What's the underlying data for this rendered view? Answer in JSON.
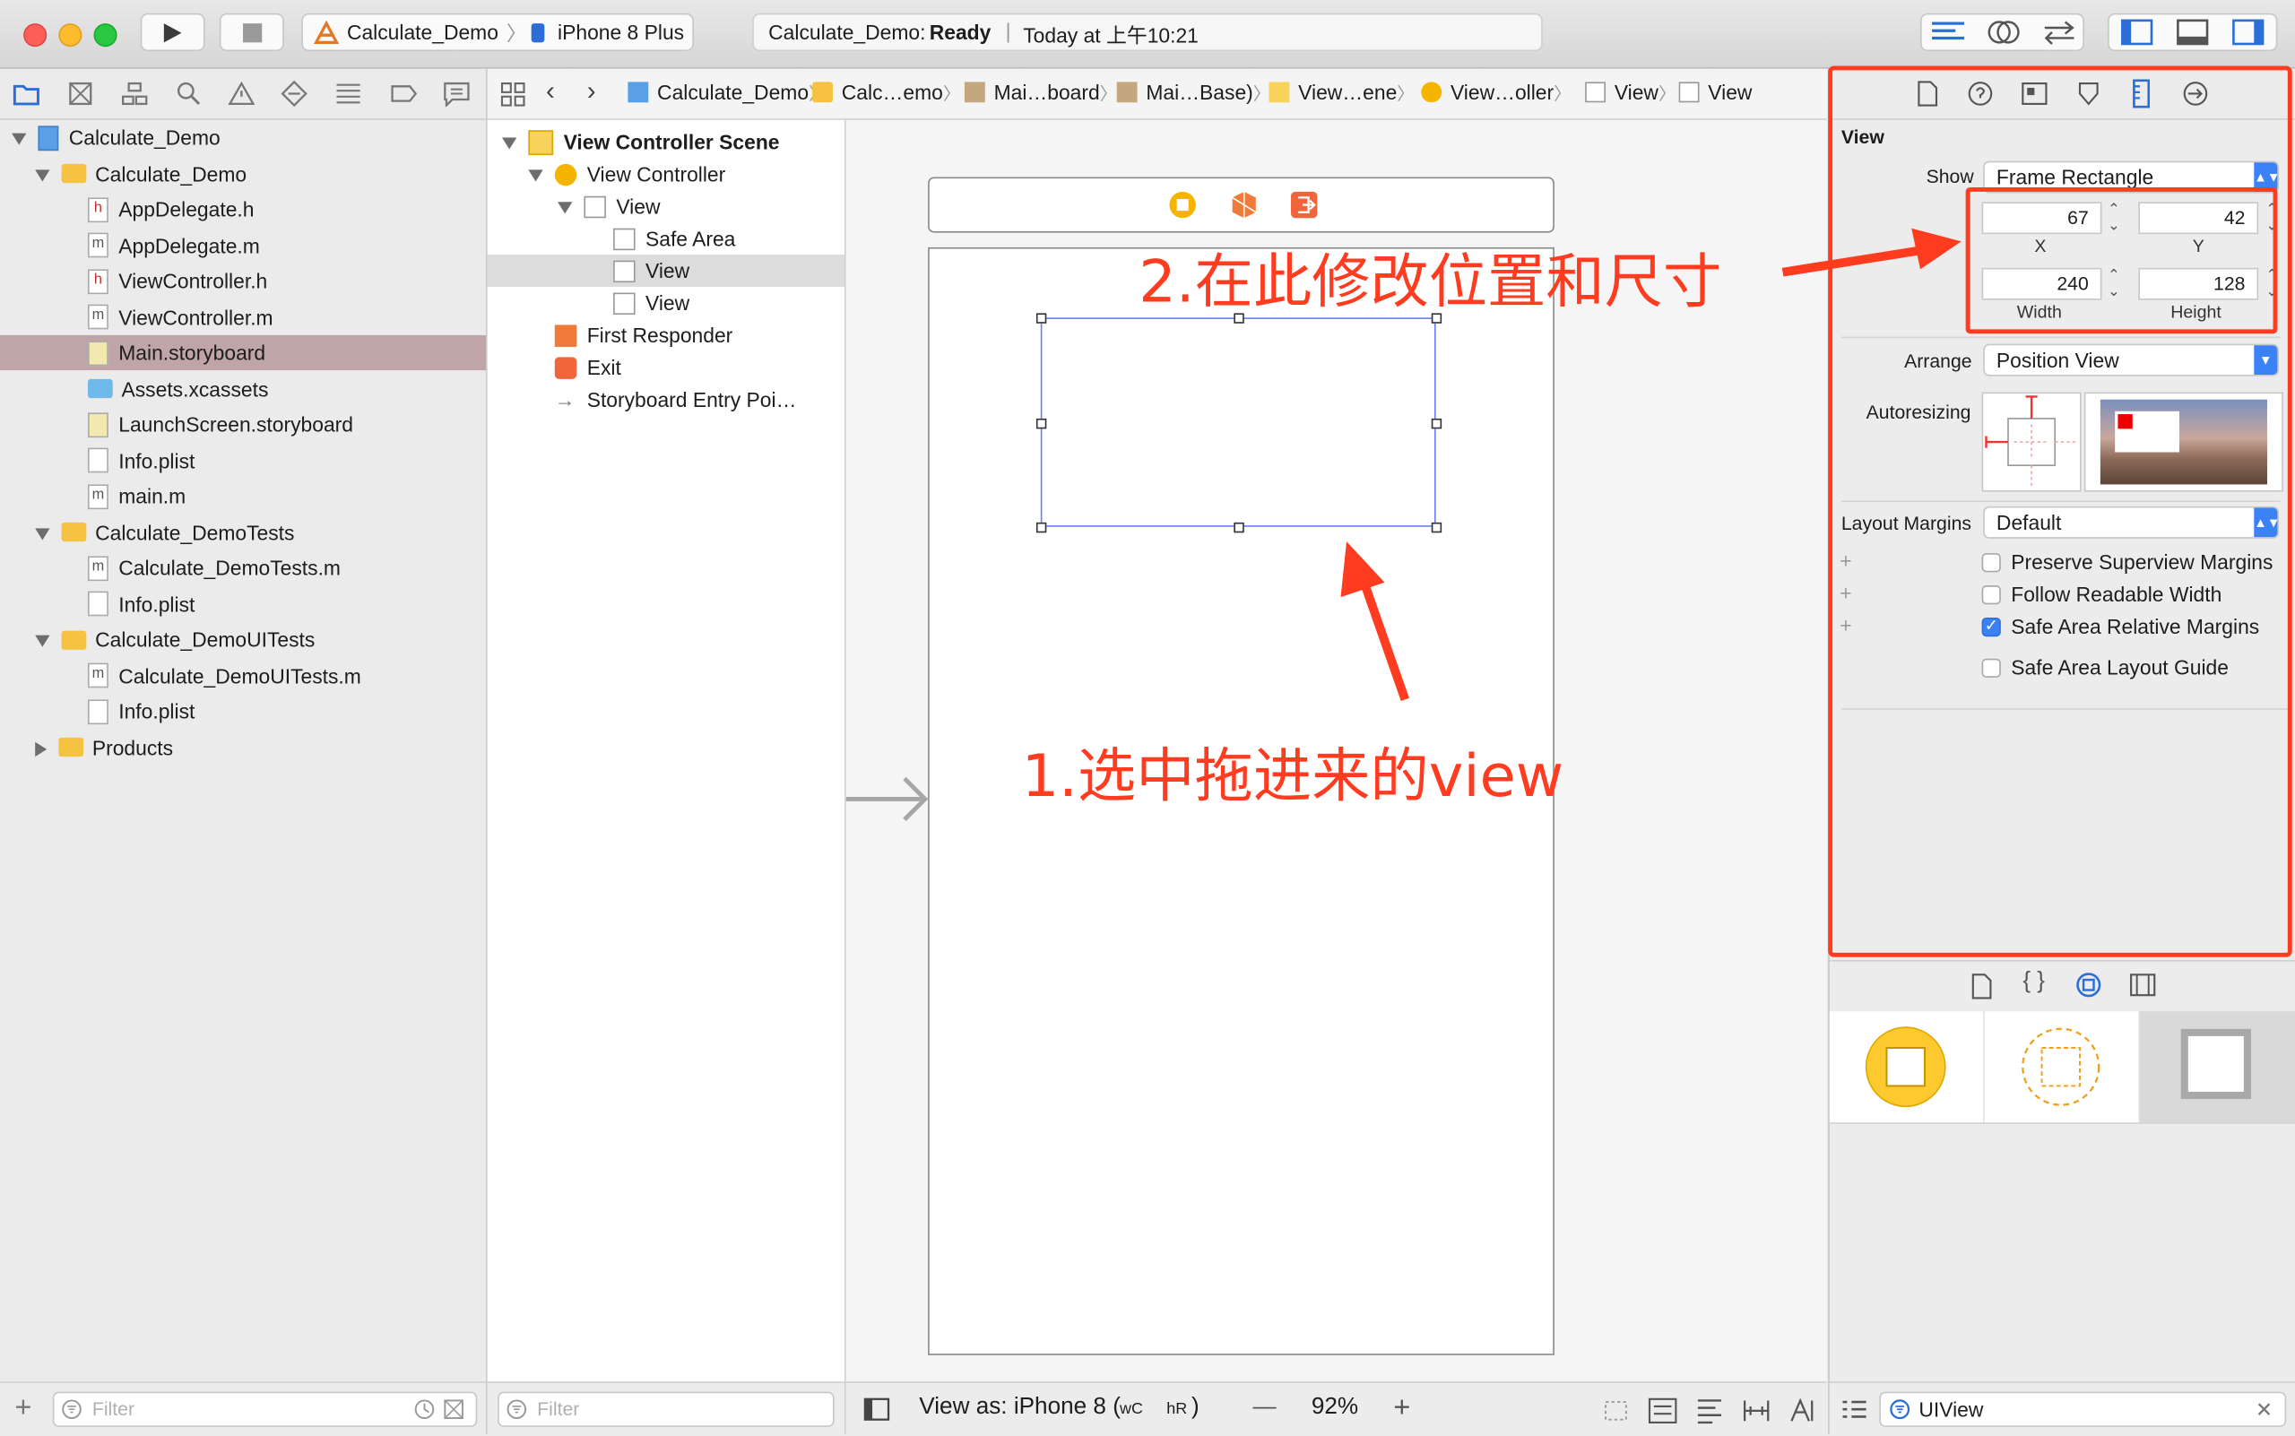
{
  "toolbar": {
    "scheme": "Calculate_Demo",
    "device": "iPhone 8 Plus",
    "status_project": "Calculate_Demo:",
    "status_state": "Ready",
    "status_time": "Today at 上午10:21"
  },
  "navigator": {
    "items": [
      {
        "label": "Calculate_Demo",
        "kind": "project",
        "level": 0,
        "open": true
      },
      {
        "label": "Calculate_Demo",
        "kind": "folder",
        "level": 1,
        "open": true
      },
      {
        "label": "AppDelegate.h",
        "kind": "h",
        "level": 2
      },
      {
        "label": "AppDelegate.m",
        "kind": "m",
        "level": 2
      },
      {
        "label": "ViewController.h",
        "kind": "h",
        "level": 2
      },
      {
        "label": "ViewController.m",
        "kind": "m",
        "level": 2
      },
      {
        "label": "Main.storyboard",
        "kind": "storyboard",
        "level": 2,
        "selected": true
      },
      {
        "label": "Assets.xcassets",
        "kind": "assets",
        "level": 2
      },
      {
        "label": "LaunchScreen.storyboard",
        "kind": "storyboard",
        "level": 2
      },
      {
        "label": "Info.plist",
        "kind": "plist",
        "level": 2
      },
      {
        "label": "main.m",
        "kind": "m",
        "level": 2
      },
      {
        "label": "Calculate_DemoTests",
        "kind": "folder",
        "level": 1,
        "open": true
      },
      {
        "label": "Calculate_DemoTests.m",
        "kind": "m",
        "level": 2
      },
      {
        "label": "Info.plist",
        "kind": "plist",
        "level": 2
      },
      {
        "label": "Calculate_DemoUITests",
        "kind": "folder",
        "level": 1,
        "open": true
      },
      {
        "label": "Calculate_DemoUITests.m",
        "kind": "m",
        "level": 2
      },
      {
        "label": "Info.plist",
        "kind": "plist",
        "level": 2
      },
      {
        "label": "Products",
        "kind": "folder",
        "level": 1,
        "open": false
      }
    ],
    "filter_placeholder": "Filter"
  },
  "jumpbar": {
    "crumbs": [
      "Calculate_Demo",
      "Calc…emo",
      "Mai…board",
      "Mai…Base)",
      "View…ene",
      "View…oller",
      "View",
      "View"
    ]
  },
  "outline": {
    "items": [
      {
        "label": "View Controller Scene",
        "level": 0,
        "bold": true
      },
      {
        "label": "View Controller",
        "level": 1
      },
      {
        "label": "View",
        "level": 2
      },
      {
        "label": "Safe Area",
        "level": 3
      },
      {
        "label": "View",
        "level": 3,
        "selected": true
      },
      {
        "label": "View",
        "level": 3
      },
      {
        "label": "First Responder",
        "level": 1
      },
      {
        "label": "Exit",
        "level": 1
      },
      {
        "label": "Storyboard Entry Poi…",
        "level": 1
      }
    ],
    "filter_placeholder": "Filter"
  },
  "canvas": {
    "view_as_label": "View as: iPhone 8 (",
    "size_class_w": "wC",
    "size_class_h": "hR",
    "view_as_close": ")",
    "zoom": "92%",
    "zoom_out": "—",
    "zoom_in": "+"
  },
  "inspector": {
    "section_title": "View",
    "show_label": "Show",
    "show_value": "Frame Rectangle",
    "x_value": "67",
    "y_value": "42",
    "width_value": "240",
    "height_value": "128",
    "x_label": "X",
    "y_label": "Y",
    "width_label": "Width",
    "height_label": "Height",
    "arrange_label": "Arrange",
    "arrange_value": "Position View",
    "autoresizing_label": "Autoresizing",
    "layout_margins_label": "Layout Margins",
    "layout_margins_value": "Default",
    "checkboxes": [
      {
        "label": "Preserve Superview Margins",
        "checked": false
      },
      {
        "label": "Follow Readable Width",
        "checked": false
      },
      {
        "label": "Safe Area Relative Margins",
        "checked": true
      },
      {
        "label": "Safe Area Layout Guide",
        "checked": false
      }
    ],
    "library_filter_value": "UIView"
  },
  "annotations": {
    "step1": "1.选中拖进来的view",
    "step2": "2.在此修改位置和尺寸"
  },
  "colors": {
    "annotation": "#ff3b20",
    "selection": "#3b82f6",
    "folder": "#f5c341"
  }
}
